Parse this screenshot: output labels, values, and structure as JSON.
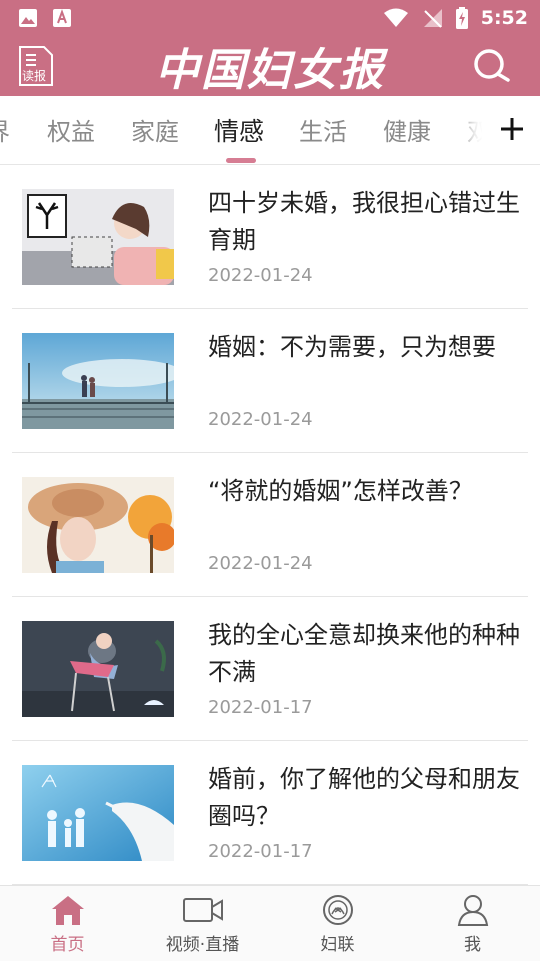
{
  "status_bar": {
    "time": "5:52"
  },
  "app_bar": {
    "read_label": "读报",
    "logo_text": "中国妇女报"
  },
  "tabs": [
    {
      "label": "界"
    },
    {
      "label": "权益"
    },
    {
      "label": "家庭"
    },
    {
      "label": "情感"
    },
    {
      "label": "生活"
    },
    {
      "label": "健康"
    },
    {
      "label": "双"
    }
  ],
  "active_tab": "情感",
  "articles": [
    {
      "title": "四十岁未婚，我很担心错过生育期",
      "date": "2022-01-24"
    },
    {
      "title": "婚姻：不为需要，只为想要",
      "date": "2022-01-24"
    },
    {
      "title": "“将就的婚姻”怎样改善？",
      "date": "2022-01-24"
    },
    {
      "title": "我的全心全意却换来他的种种不满",
      "date": "2022-01-17"
    },
    {
      "title": "婚前，你了解他的父母和朋友圈吗？",
      "date": "2022-01-17"
    }
  ],
  "bottom_nav": [
    {
      "label": "首页",
      "icon": "home-icon"
    },
    {
      "label": "视频·直播",
      "icon": "video-icon"
    },
    {
      "label": "妇联",
      "icon": "federation-emblem-icon"
    },
    {
      "label": "我",
      "icon": "profile-icon"
    }
  ],
  "colors": {
    "brand": "#c96f84",
    "active_nav": "#c96f84",
    "indicator": "#d67d93"
  }
}
